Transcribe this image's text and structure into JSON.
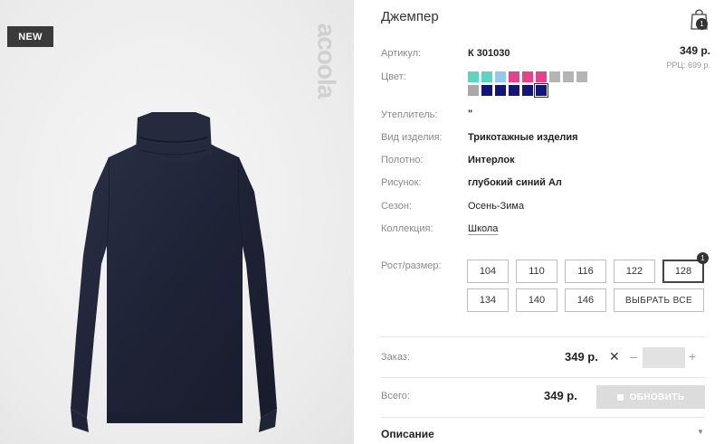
{
  "badge": "NEW",
  "watermark": "acoola",
  "product": {
    "title": "Джемпер",
    "cart_count": "1",
    "price": "349 р.",
    "rrp": "РРЦ: 699 р."
  },
  "attributes": [
    {
      "label": "Артикул:",
      "value": "К 301030"
    },
    {
      "label": "Цвет:",
      "value": ""
    },
    {
      "label": "Утеплитель:",
      "value": "\""
    },
    {
      "label": "Вид изделия:",
      "value": "Трикотажные изделия"
    },
    {
      "label": "Полотно:",
      "value": "Интерлок"
    },
    {
      "label": "Рисунок:",
      "value": "глубокий синий Ал"
    },
    {
      "label": "Сезон:",
      "value": "Осень-Зима"
    },
    {
      "label": "Коллекция:",
      "value": "Школа"
    }
  ],
  "colors": {
    "swatches": [
      "#5ad6c0",
      "#5ad6c0",
      "#8fc9f0",
      "#e8408c",
      "#e8408c",
      "#e8408c",
      "#b5b5b5",
      "#b5b5b5",
      "#b5b5b5",
      "#a8a8a8",
      "#14157a",
      "#14157a",
      "#14157a",
      "#14157a",
      "#14157a"
    ],
    "selected_index": 14
  },
  "sizes": {
    "label": "Рост/размер:",
    "items": [
      "104",
      "110",
      "116",
      "122",
      "128",
      "134",
      "140",
      "146"
    ],
    "select_all": "ВЫБРАТЬ ВСЕ",
    "selected": "128",
    "selected_count": "1"
  },
  "order": {
    "label": "Заказ:",
    "price": "349 р.",
    "times": "✕",
    "minus": "–",
    "plus": "+",
    "qty": ""
  },
  "total": {
    "label": "Всего:",
    "price": "349 р.",
    "button": "ОБНОВИТЬ"
  },
  "description": {
    "label": "Описание",
    "chevron": "▼"
  }
}
